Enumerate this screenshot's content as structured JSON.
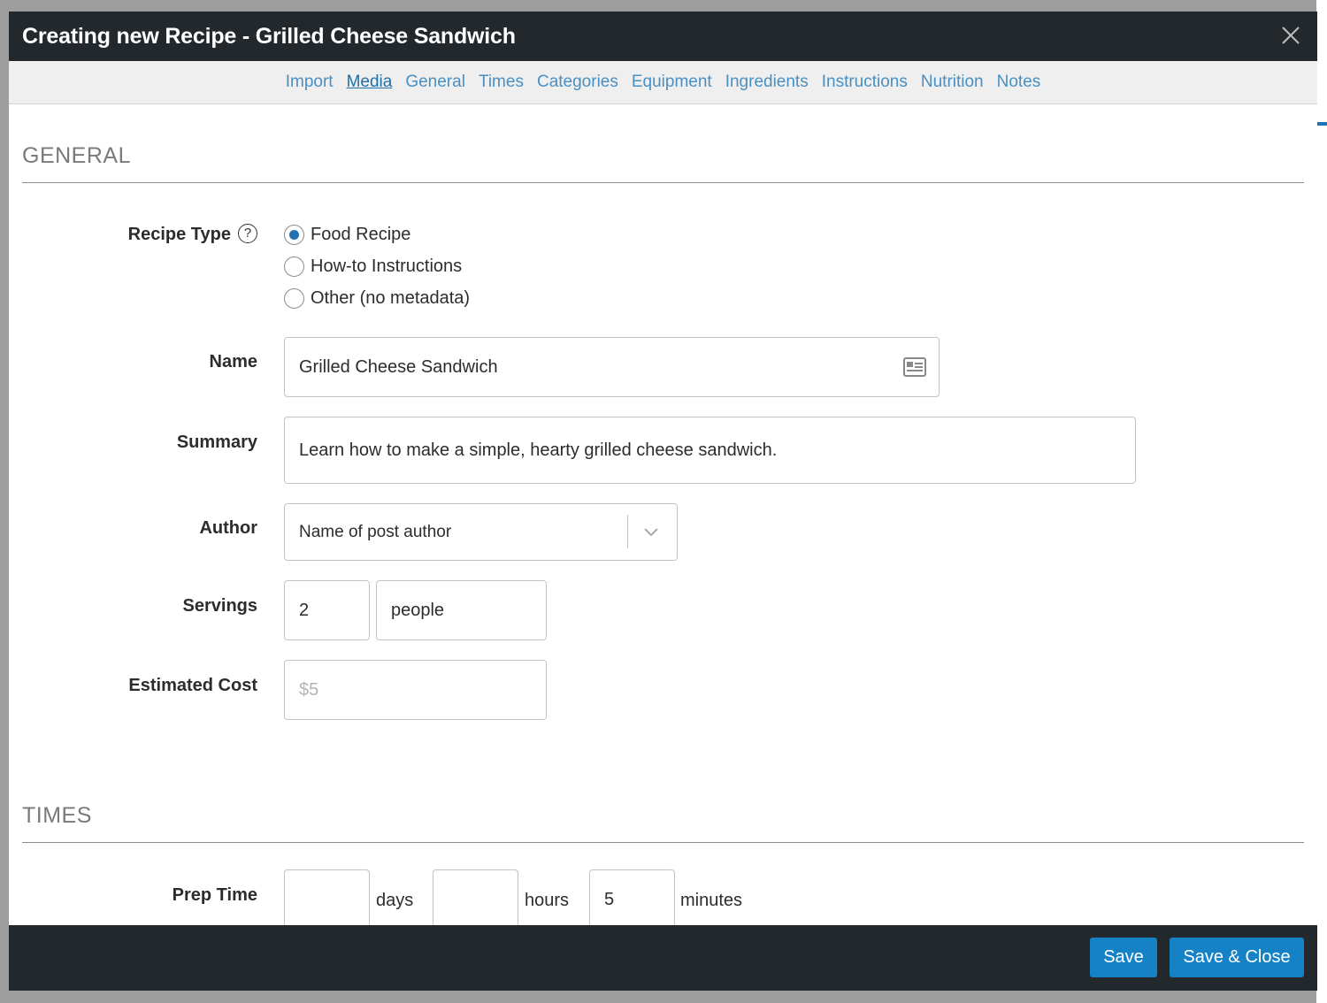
{
  "modal": {
    "title": "Creating new Recipe - Grilled Cheese Sandwich",
    "close_icon": "close-icon"
  },
  "nav": {
    "items": [
      {
        "label": "Import",
        "active": false
      },
      {
        "label": "Media",
        "active": true
      },
      {
        "label": "General",
        "active": false
      },
      {
        "label": "Times",
        "active": false
      },
      {
        "label": "Categories",
        "active": false
      },
      {
        "label": "Equipment",
        "active": false
      },
      {
        "label": "Ingredients",
        "active": false
      },
      {
        "label": "Instructions",
        "active": false
      },
      {
        "label": "Nutrition",
        "active": false
      },
      {
        "label": "Notes",
        "active": false
      }
    ]
  },
  "general": {
    "section_title": "GENERAL",
    "recipe_type": {
      "label": "Recipe Type",
      "help": "?",
      "options": [
        {
          "label": "Food Recipe",
          "checked": true
        },
        {
          "label": "How-to Instructions",
          "checked": false
        },
        {
          "label": "Other (no metadata)",
          "checked": false
        }
      ]
    },
    "name": {
      "label": "Name",
      "value": "Grilled Cheese Sandwich"
    },
    "summary": {
      "label": "Summary",
      "value": "Learn how to make a simple, hearty grilled cheese sandwich."
    },
    "author": {
      "label": "Author",
      "value": "Name of post author"
    },
    "servings": {
      "label": "Servings",
      "amount": "2",
      "unit": "people"
    },
    "cost": {
      "label": "Estimated Cost",
      "placeholder": "$5"
    }
  },
  "times": {
    "section_title": "TIMES",
    "prep": {
      "label": "Prep Time",
      "days": "",
      "days_unit": "days",
      "hours": "",
      "hours_unit": "hours",
      "minutes": "5",
      "minutes_unit": "minutes"
    }
  },
  "footer": {
    "save_label": "Save",
    "save_close_label": "Save & Close"
  },
  "colors": {
    "header_bg": "#23282d",
    "link": "#4a8fc2",
    "accent": "#2271b1",
    "button": "#1682c6"
  }
}
